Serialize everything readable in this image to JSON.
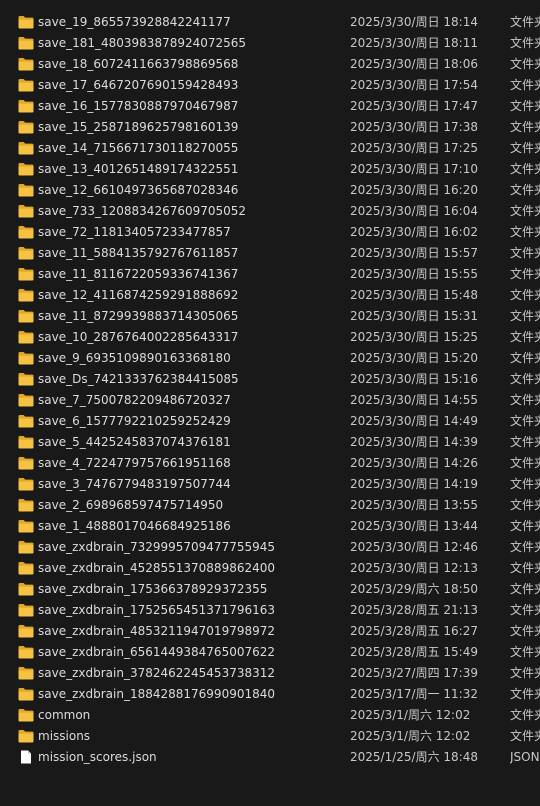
{
  "colors": {
    "background": "#191919",
    "text": "#dcdcdc",
    "folder": "#f5c242",
    "folder_back": "#e0a82a",
    "file": "#ffffff"
  },
  "files": [
    {
      "name": "save_19_865573928842241177",
      "date": "2025/3/30/周日 18:14",
      "type": "文件夹",
      "icon": "folder-icon"
    },
    {
      "name": "save_181_4803983878924072565",
      "date": "2025/3/30/周日 18:11",
      "type": "文件夹",
      "icon": "folder-icon"
    },
    {
      "name": "save_18_6072411663798869568",
      "date": "2025/3/30/周日 18:06",
      "type": "文件夹",
      "icon": "folder-icon"
    },
    {
      "name": "save_17_6467207690159428493",
      "date": "2025/3/30/周日 17:54",
      "type": "文件夹",
      "icon": "folder-icon"
    },
    {
      "name": "save_16_1577830887970467987",
      "date": "2025/3/30/周日 17:47",
      "type": "文件夹",
      "icon": "folder-icon"
    },
    {
      "name": "save_15_2587189625798160139",
      "date": "2025/3/30/周日 17:38",
      "type": "文件夹",
      "icon": "folder-icon"
    },
    {
      "name": "save_14_7156671730118270055",
      "date": "2025/3/30/周日 17:25",
      "type": "文件夹",
      "icon": "folder-icon"
    },
    {
      "name": "save_13_4012651489174322551",
      "date": "2025/3/30/周日 17:10",
      "type": "文件夹",
      "icon": "folder-icon"
    },
    {
      "name": "save_12_6610497365687028346",
      "date": "2025/3/30/周日 16:20",
      "type": "文件夹",
      "icon": "folder-icon"
    },
    {
      "name": "save_733_1208834267609705052",
      "date": "2025/3/30/周日 16:04",
      "type": "文件夹",
      "icon": "folder-icon"
    },
    {
      "name": "save_72_118134057233477857",
      "date": "2025/3/30/周日 16:02",
      "type": "文件夹",
      "icon": "folder-icon"
    },
    {
      "name": "save_11_5884135792767611857",
      "date": "2025/3/30/周日 15:57",
      "type": "文件夹",
      "icon": "folder-icon"
    },
    {
      "name": "save_11_8116722059336741367",
      "date": "2025/3/30/周日 15:55",
      "type": "文件夹",
      "icon": "folder-icon"
    },
    {
      "name": "save_12_4116874259291888692",
      "date": "2025/3/30/周日 15:48",
      "type": "文件夹",
      "icon": "folder-icon"
    },
    {
      "name": "save_11_8729939883714305065",
      "date": "2025/3/30/周日 15:31",
      "type": "文件夹",
      "icon": "folder-icon"
    },
    {
      "name": "save_10_2876764002285643317",
      "date": "2025/3/30/周日 15:25",
      "type": "文件夹",
      "icon": "folder-icon"
    },
    {
      "name": "save_9_6935109890163368180",
      "date": "2025/3/30/周日 15:20",
      "type": "文件夹",
      "icon": "folder-icon"
    },
    {
      "name": "save_Ds_7421333762384415085",
      "date": "2025/3/30/周日 15:16",
      "type": "文件夹",
      "icon": "folder-icon"
    },
    {
      "name": "save_7_7500782209486720327",
      "date": "2025/3/30/周日 14:55",
      "type": "文件夹",
      "icon": "folder-icon"
    },
    {
      "name": "save_6_1577792210259252429",
      "date": "2025/3/30/周日 14:49",
      "type": "文件夹",
      "icon": "folder-icon"
    },
    {
      "name": "save_5_4425245837074376181",
      "date": "2025/3/30/周日 14:39",
      "type": "文件夹",
      "icon": "folder-icon"
    },
    {
      "name": "save_4_7224779757661951168",
      "date": "2025/3/30/周日 14:26",
      "type": "文件夹",
      "icon": "folder-icon"
    },
    {
      "name": "save_3_7476779483197507744",
      "date": "2025/3/30/周日 14:19",
      "type": "文件夹",
      "icon": "folder-icon"
    },
    {
      "name": "save_2_698968597475714950",
      "date": "2025/3/30/周日 13:55",
      "type": "文件夹",
      "icon": "folder-icon"
    },
    {
      "name": "save_1_4888017046684925186",
      "date": "2025/3/30/周日 13:44",
      "type": "文件夹",
      "icon": "folder-icon"
    },
    {
      "name": "save_zxdbrain_7329995709477755945",
      "date": "2025/3/30/周日 12:46",
      "type": "文件夹",
      "icon": "folder-icon"
    },
    {
      "name": "save_zxdbrain_4528551370889862400",
      "date": "2025/3/30/周日 12:13",
      "type": "文件夹",
      "icon": "folder-icon"
    },
    {
      "name": "save_zxdbrain_175366378929372355",
      "date": "2025/3/29/周六 18:50",
      "type": "文件夹",
      "icon": "folder-icon"
    },
    {
      "name": "save_zxdbrain_1752565451371796163",
      "date": "2025/3/28/周五 21:13",
      "type": "文件夹",
      "icon": "folder-icon"
    },
    {
      "name": "save_zxdbrain_4853211947019798972",
      "date": "2025/3/28/周五 16:27",
      "type": "文件夹",
      "icon": "folder-icon"
    },
    {
      "name": "save_zxdbrain_6561449384765007622",
      "date": "2025/3/28/周五 15:49",
      "type": "文件夹",
      "icon": "folder-icon"
    },
    {
      "name": "save_zxdbrain_3782462245453738312",
      "date": "2025/3/27/周四 17:39",
      "type": "文件夹",
      "icon": "folder-icon"
    },
    {
      "name": "save_zxdbrain_1884288176990901840",
      "date": "2025/3/17/周一 11:32",
      "type": "文件夹",
      "icon": "folder-icon"
    },
    {
      "name": "common",
      "date": "2025/3/1/周六 12:02",
      "type": "文件夹",
      "icon": "folder-icon"
    },
    {
      "name": "missions",
      "date": "2025/3/1/周六 12:02",
      "type": "文件夹",
      "icon": "folder-icon"
    },
    {
      "name": "mission_scores.json",
      "date": "2025/1/25/周六 18:48",
      "type": "JSON",
      "icon": "file-icon"
    }
  ]
}
